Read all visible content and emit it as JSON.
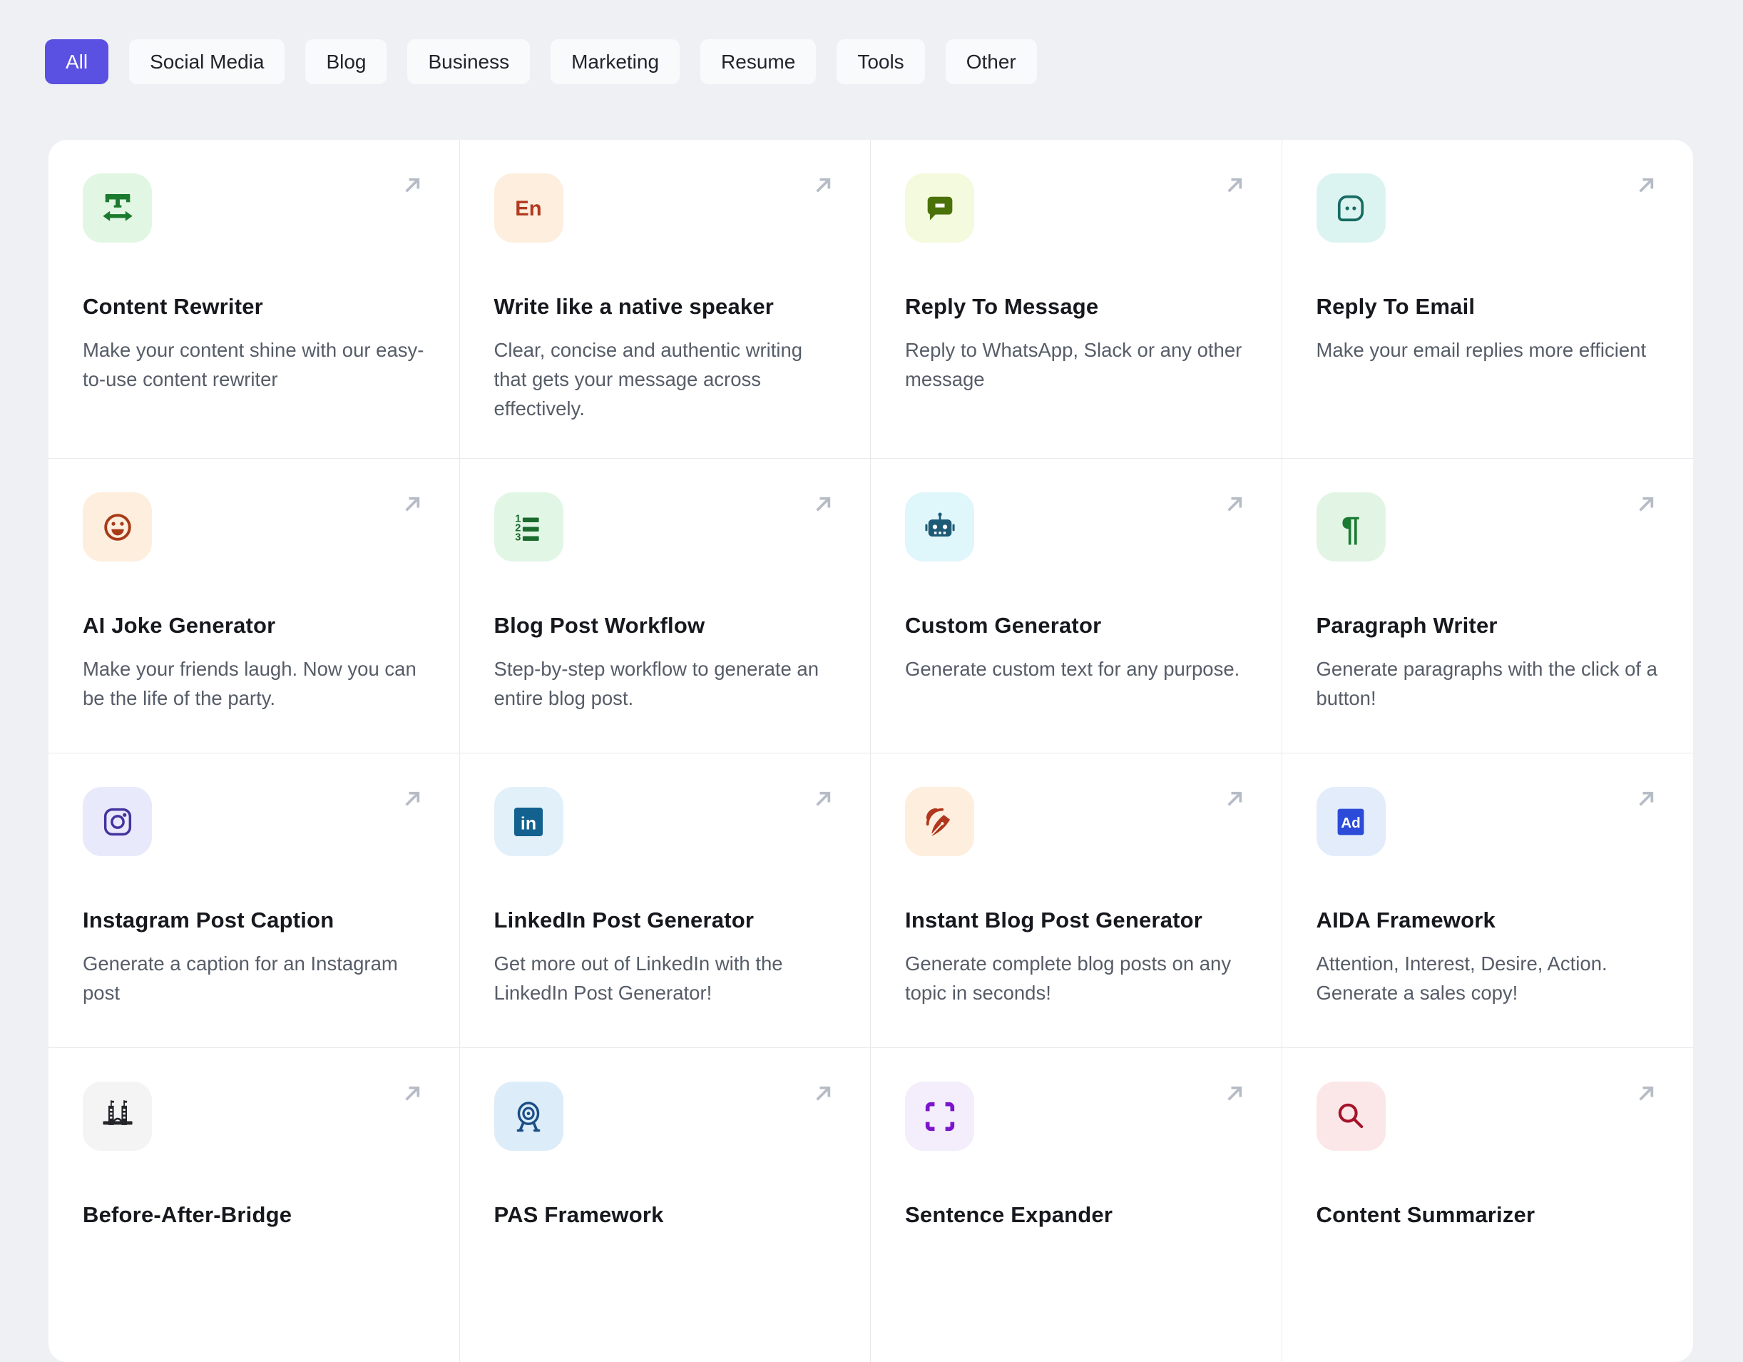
{
  "colors": {
    "page_bg": "#eef0f4",
    "panel_bg": "#ffffff",
    "accent": "#5a50e2",
    "divider": "#e8e9ec",
    "title_text": "#16181d",
    "desc_text": "#565d68",
    "arrow_icon": "#b6bcc6"
  },
  "filter_bar": {
    "tabs": [
      {
        "label": "All",
        "active": true
      },
      {
        "label": "Social Media",
        "active": false
      },
      {
        "label": "Blog",
        "active": false
      },
      {
        "label": "Business",
        "active": false
      },
      {
        "label": "Marketing",
        "active": false
      },
      {
        "label": "Resume",
        "active": false
      },
      {
        "label": "Tools",
        "active": false
      },
      {
        "label": "Other",
        "active": false
      }
    ]
  },
  "cards": [
    {
      "title": "Content Rewriter",
      "description": "Make your content shine with our easy-to-use content rewriter",
      "icon": "text-width-icon",
      "icon_bg": "#e2f6e4",
      "icon_fg": "#1b7a2d"
    },
    {
      "title": "Write like a native speaker",
      "description": "Clear, concise and authentic writing that gets your message across effectively.",
      "icon": "en-language-icon",
      "icon_bg": "#fdeede",
      "icon_fg": "#b13a1f"
    },
    {
      "title": "Reply To Message",
      "description": "Reply to WhatsApp, Slack or any other message",
      "icon": "message-minus-icon",
      "icon_bg": "#f4fade",
      "icon_fg": "#4a7209"
    },
    {
      "title": "Reply To Email",
      "description": "Make your email replies more efficient",
      "icon": "message-dots-icon",
      "icon_bg": "#dcf4f1",
      "icon_fg": "#176b63"
    },
    {
      "title": "AI Joke Generator",
      "description": "Make your friends laugh. Now you can be the life of the party.",
      "icon": "smiley-icon",
      "icon_bg": "#fdeede",
      "icon_fg": "#a83a18"
    },
    {
      "title": "Blog Post Workflow",
      "description": "Step-by-step workflow to generate an entire blog post.",
      "icon": "numbered-list-icon",
      "icon_bg": "#e2f6e6",
      "icon_fg": "#1a6b2d"
    },
    {
      "title": "Custom Generator",
      "description": "Generate custom text for any purpose.",
      "icon": "robot-icon",
      "icon_bg": "#dff6fb",
      "icon_fg": "#1d5a75"
    },
    {
      "title": "Paragraph Writer",
      "description": "Generate paragraphs with the click of a button!",
      "icon": "pilcrow-icon",
      "icon_bg": "#e2f5e4",
      "icon_fg": "#1a7a33"
    },
    {
      "title": "Instagram Post Caption",
      "description": "Generate a caption for an Instagram post",
      "icon": "instagram-icon",
      "icon_bg": "#e8eafb",
      "icon_fg": "#43339e"
    },
    {
      "title": "LinkedIn Post Generator",
      "description": "Get more out of LinkedIn with the LinkedIn Post Generator!",
      "icon": "linkedin-icon",
      "icon_bg": "#e2f0fa",
      "icon_fg": "#13618f"
    },
    {
      "title": "Instant Blog Post Generator",
      "description": "Generate complete blog posts on any topic in seconds!",
      "icon": "quill-signal-icon",
      "icon_bg": "#fdeedd",
      "icon_fg": "#b0371d"
    },
    {
      "title": "AIDA Framework",
      "description": "Attention, Interest, Desire, Action. Generate a sales copy!",
      "icon": "ad-badge-icon",
      "icon_bg": "#e3ecfa",
      "icon_fg": "#2b4bd8"
    },
    {
      "title": "Before-After-Bridge",
      "description": "",
      "icon": "bridge-icon",
      "icon_bg": "#f4f4f5",
      "icon_fg": "#232529"
    },
    {
      "title": "PAS Framework",
      "description": "",
      "icon": "target-stand-icon",
      "icon_bg": "#dcedf9",
      "icon_fg": "#1c4e86"
    },
    {
      "title": "Sentence Expander",
      "description": "",
      "icon": "expand-icon",
      "icon_bg": "#f3edfc",
      "icon_fg": "#7a15cb"
    },
    {
      "title": "Content Summarizer",
      "description": "",
      "icon": "magnifier-icon",
      "icon_bg": "#fbe7e8",
      "icon_fg": "#a5132a"
    }
  ]
}
